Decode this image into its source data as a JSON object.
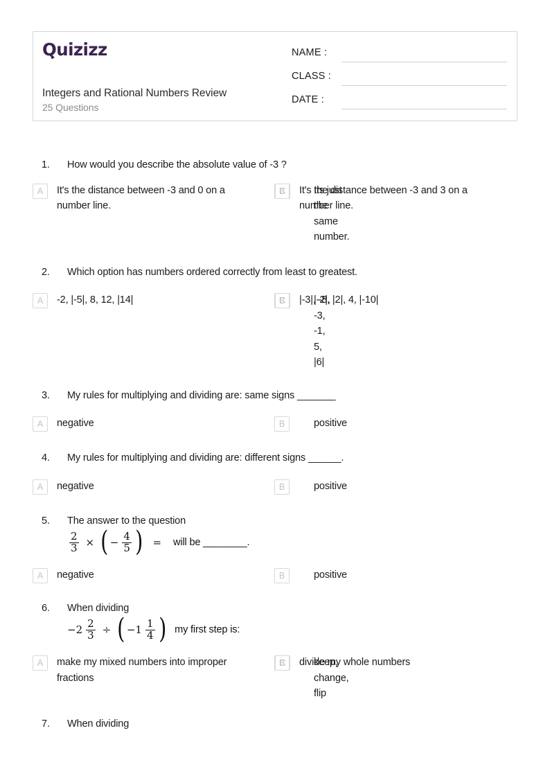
{
  "header": {
    "logo_text": "Quizizz",
    "quiz_title": "Integers and Rational Numbers Review",
    "question_count": "25 Questions",
    "fields": [
      {
        "label": "NAME :",
        "value": ""
      },
      {
        "label": "CLASS :",
        "value": ""
      },
      {
        "label": "DATE  :",
        "value": ""
      }
    ],
    "brand_color": "#3d2352"
  },
  "questions": [
    {
      "number": "1.",
      "text": "How would you describe the absolute value of -3 ?",
      "options": [
        {
          "letter": "A",
          "text": "It's the distance between -3 and 0 on a number line."
        },
        {
          "letter": "B",
          "text": "Its just the same number."
        },
        {
          "letter": "C",
          "text": "It's the distance between -3 and 3 on a number line."
        }
      ]
    },
    {
      "number": "2.",
      "text": "Which option has numbers ordered correctly from least to greatest.",
      "options": [
        {
          "letter": "A",
          "text": "-2, |-5|, 8, 12, |14|"
        },
        {
          "letter": "B",
          "text": "|-2|, -3, -1, 5, |6|"
        },
        {
          "letter": "C",
          "text": "|-3|, -8, |2|, 4, |-10|"
        }
      ]
    },
    {
      "number": "3.",
      "text": "My rules for multiplying and dividing are: same signs _______",
      "options": [
        {
          "letter": "A",
          "text": "negative"
        },
        {
          "letter": "B",
          "text": "positive"
        }
      ]
    },
    {
      "number": "4.",
      "text": "My rules for multiplying and dividing are: different signs ______.",
      "options": [
        {
          "letter": "A",
          "text": "negative"
        },
        {
          "letter": "B",
          "text": "positive"
        }
      ]
    },
    {
      "number": "5.",
      "text": "The answer to the question",
      "math": {
        "left_whole": "",
        "frac1_num": "2",
        "frac1_den": "3",
        "operator": "×",
        "paren_sign": "−",
        "frac2_num": "4",
        "frac2_den": "5",
        "equals": "=",
        "tail": "will be ________."
      },
      "options": [
        {
          "letter": "A",
          "text": "negative"
        },
        {
          "letter": "B",
          "text": "positive"
        }
      ]
    },
    {
      "number": "6.",
      "text": "When dividing",
      "math": {
        "left_whole": "−2",
        "frac1_num": "2",
        "frac1_den": "3",
        "operator": "÷",
        "paren_sign": "−1",
        "frac2_num": "1",
        "frac2_den": "4",
        "equals": "",
        "tail": "my first step is:"
      },
      "options": [
        {
          "letter": "A",
          "text": "make my mixed numbers into improper fractions"
        },
        {
          "letter": "B",
          "text": "keep, change, flip"
        },
        {
          "letter": "C",
          "text": "divide my whole numbers"
        }
      ]
    },
    {
      "number": "7.",
      "text": "When dividing",
      "options": []
    }
  ]
}
